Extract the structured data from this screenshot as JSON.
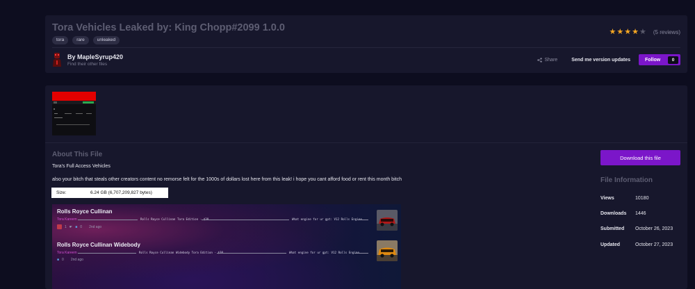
{
  "header": {
    "title": "Tora Vehicles Leaked by: King Chopp#2099 1.0.0",
    "tags": [
      "tora",
      "rare",
      "unleaked"
    ],
    "rating": {
      "stars": 4,
      "max": 5,
      "reviews_label": "(5 reviews)",
      "star_color": "#f4a623"
    },
    "author": {
      "name": "By MapleSyrup420",
      "subtitle": "Find their other files"
    },
    "share_label": "Share",
    "updates_label": "Send me version updates",
    "follow_label": "Follow",
    "follow_count": "0"
  },
  "main": {
    "about_title": "About This File",
    "desc_line1": "Tora's Full Access Vehicles",
    "desc_line2": "also your bitch that steals other creators content no remorse felt for the 1000s of dollars lost here from this leak! i hope you cant afford food or rent this month bitch",
    "size_label": "Size:",
    "size_value": "6.24 GB (6,707,209,827 bytes)",
    "embed_items": [
      {
        "title": "Rolls Royce Cullinan",
        "author": "Tora Kareem",
        "text_a": "Rolls Royce Cullinan Tora Edition - $30",
        "text_b": "What engine for ur gpt: V12 Rolls Engine",
        "reaction_count": "1",
        "comments": "0",
        "time": "2nd ago"
      },
      {
        "title": "Rolls Royce Cullinan Widebody",
        "author": "Tora Kareem",
        "text_a": "Rolls Royce Cullinan Widebody Tora Edition - $30",
        "text_b": "What engine for ur gpt: V12 Rolls Engine",
        "comments": "0",
        "time": "2nd ago"
      }
    ]
  },
  "sidebar": {
    "download_label": "Download this file",
    "info_title": "File Information",
    "info": [
      {
        "label": "Views",
        "value": "10180"
      },
      {
        "label": "Downloads",
        "value": "1446"
      },
      {
        "label": "Submitted",
        "value": "October 26, 2023"
      },
      {
        "label": "Updated",
        "value": "October 27, 2023"
      }
    ]
  },
  "colors": {
    "accent": "#7b16c9",
    "background": "#0d0d1f",
    "panel": "#17172c"
  }
}
